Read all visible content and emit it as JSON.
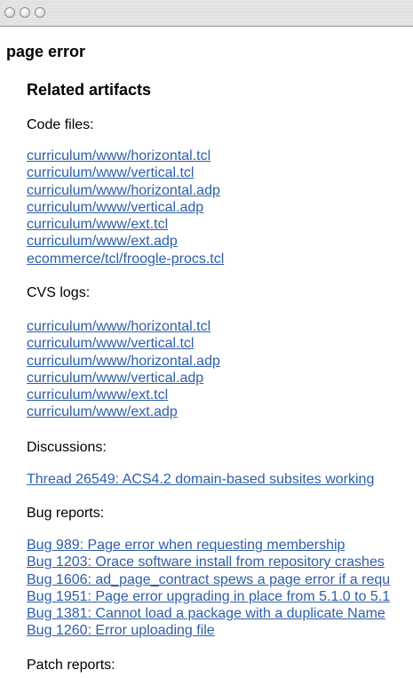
{
  "page": {
    "title": "page error"
  },
  "artifacts": {
    "heading": "Related artifacts",
    "code_files": {
      "label": "Code files:",
      "links": [
        "curriculum/www/horizontal.tcl",
        "curriculum/www/vertical.tcl",
        "curriculum/www/horizontal.adp",
        "curriculum/www/vertical.adp",
        "curriculum/www/ext.tcl",
        "curriculum/www/ext.adp",
        "ecommerce/tcl/froogle-procs.tcl"
      ]
    },
    "cvs_logs": {
      "label": "CVS logs:",
      "links": [
        "curriculum/www/horizontal.tcl",
        "curriculum/www/vertical.tcl",
        "curriculum/www/horizontal.adp",
        "curriculum/www/vertical.adp",
        "curriculum/www/ext.tcl",
        "curriculum/www/ext.adp"
      ]
    },
    "discussions": {
      "label": "Discussions:",
      "links": [
        "Thread 26549: ACS4.2 domain-based subsites working"
      ]
    },
    "bug_reports": {
      "label": "Bug reports:",
      "links": [
        "Bug 989: Page error when requesting membership",
        "Bug 1203: Orace software install from repository crashes",
        "Bug 1606: ad_page_contract spews a page error if a requ",
        "Bug 1951: Page error upgrading in place from 5.1.0 to 5.1",
        "Bug 1381: Cannot load a package with a duplicate Name",
        "Bug 1260: Error uploading file"
      ]
    },
    "patch_reports": {
      "label": "Patch reports:"
    }
  }
}
